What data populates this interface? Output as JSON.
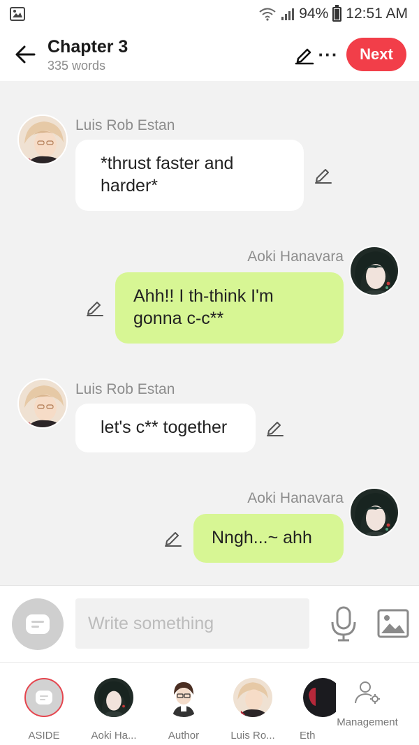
{
  "status_bar": {
    "battery": "94%",
    "time": "12:51 AM"
  },
  "header": {
    "title": "Chapter 3",
    "word_count": "335 words",
    "next_label": "Next"
  },
  "messages": [
    {
      "side": "left",
      "sender": "Luis Rob Estan",
      "text_lines": [
        "*thrust faster and",
        "harder*"
      ]
    },
    {
      "side": "right",
      "sender": "Aoki Hanavara",
      "text_lines": [
        "Ahh!! I th-think I'm",
        "gonna c-c**"
      ]
    },
    {
      "side": "left",
      "sender": "Luis Rob Estan",
      "text_lines": [
        "let's c** together"
      ]
    },
    {
      "side": "right",
      "sender": "Aoki Hanavara",
      "text_lines": [
        "Nngh...~ ahh"
      ]
    }
  ],
  "composer": {
    "placeholder": "Write something"
  },
  "characters": [
    {
      "label": "ASIDE"
    },
    {
      "label": "Aoki Ha..."
    },
    {
      "label": "Author"
    },
    {
      "label": "Luis Ro..."
    },
    {
      "label": "Eth"
    }
  ],
  "management_label": "Management",
  "colors": {
    "accent": "#f23e49",
    "right_bubble": "#d7f694",
    "left_bubble": "#ffffff",
    "background": "#f2f2f2"
  }
}
